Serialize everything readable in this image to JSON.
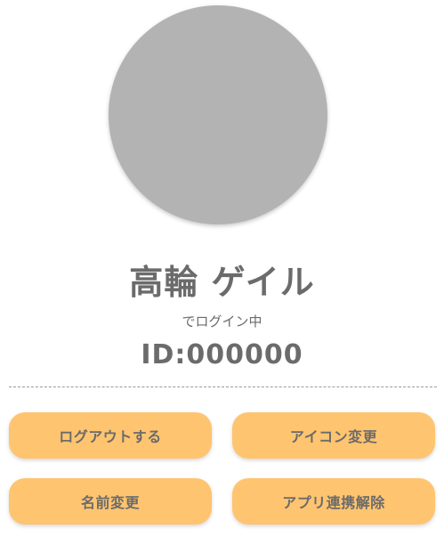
{
  "profile": {
    "name": "高輪 ゲイル",
    "login_status": "でログイン中",
    "id_text": "ID:000000"
  },
  "actions": {
    "logout_label": "ログアウトする",
    "change_icon_label": "アイコン変更",
    "change_name_label": "名前変更",
    "unlink_app_label": "アプリ連携解除"
  },
  "colors": {
    "button_bg": "#ffc46f",
    "avatar_bg": "#b3b3b3",
    "text": "#6b6b6b"
  }
}
